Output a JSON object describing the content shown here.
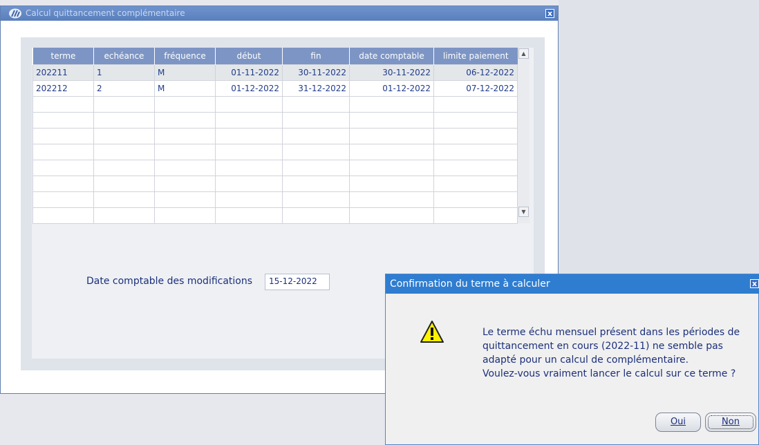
{
  "main_window": {
    "title": "Calcul quittancement complémentaire",
    "close_glyph": "x"
  },
  "table": {
    "columns": [
      "terme",
      "echéance",
      "fréquence",
      "début",
      "fin",
      "date comptable",
      "limite paiement"
    ],
    "rows": [
      [
        "202211",
        "1",
        "M",
        "01-11-2022",
        "30-11-2022",
        "30-11-2022",
        "06-12-2022"
      ],
      [
        "202212",
        "2",
        "M",
        "01-12-2022",
        "31-12-2022",
        "01-12-2022",
        "07-12-2022"
      ]
    ],
    "empty_rows": 8
  },
  "form": {
    "date_label": "Date comptable des modifications",
    "date_value": "15-12-2022"
  },
  "dialog": {
    "title": "Confirmation du terme à calculer",
    "close_glyph": "x",
    "message_lines": [
      "Le terme échu mensuel présent dans les périodes de",
      "quittancement en cours (2022-11) ne semble pas",
      "adapté pour un calcul de complémentaire.",
      "Voulez-vous vraiment lancer le calcul sur ce terme ?"
    ],
    "oui_label": "Oui",
    "non_label": "Non"
  },
  "colors": {
    "title_bar": "#5a7fbe",
    "dialog_title_bar": "#2f7dd0",
    "header_bg": "#7d95c4",
    "text_blue": "#1f3b8a"
  }
}
